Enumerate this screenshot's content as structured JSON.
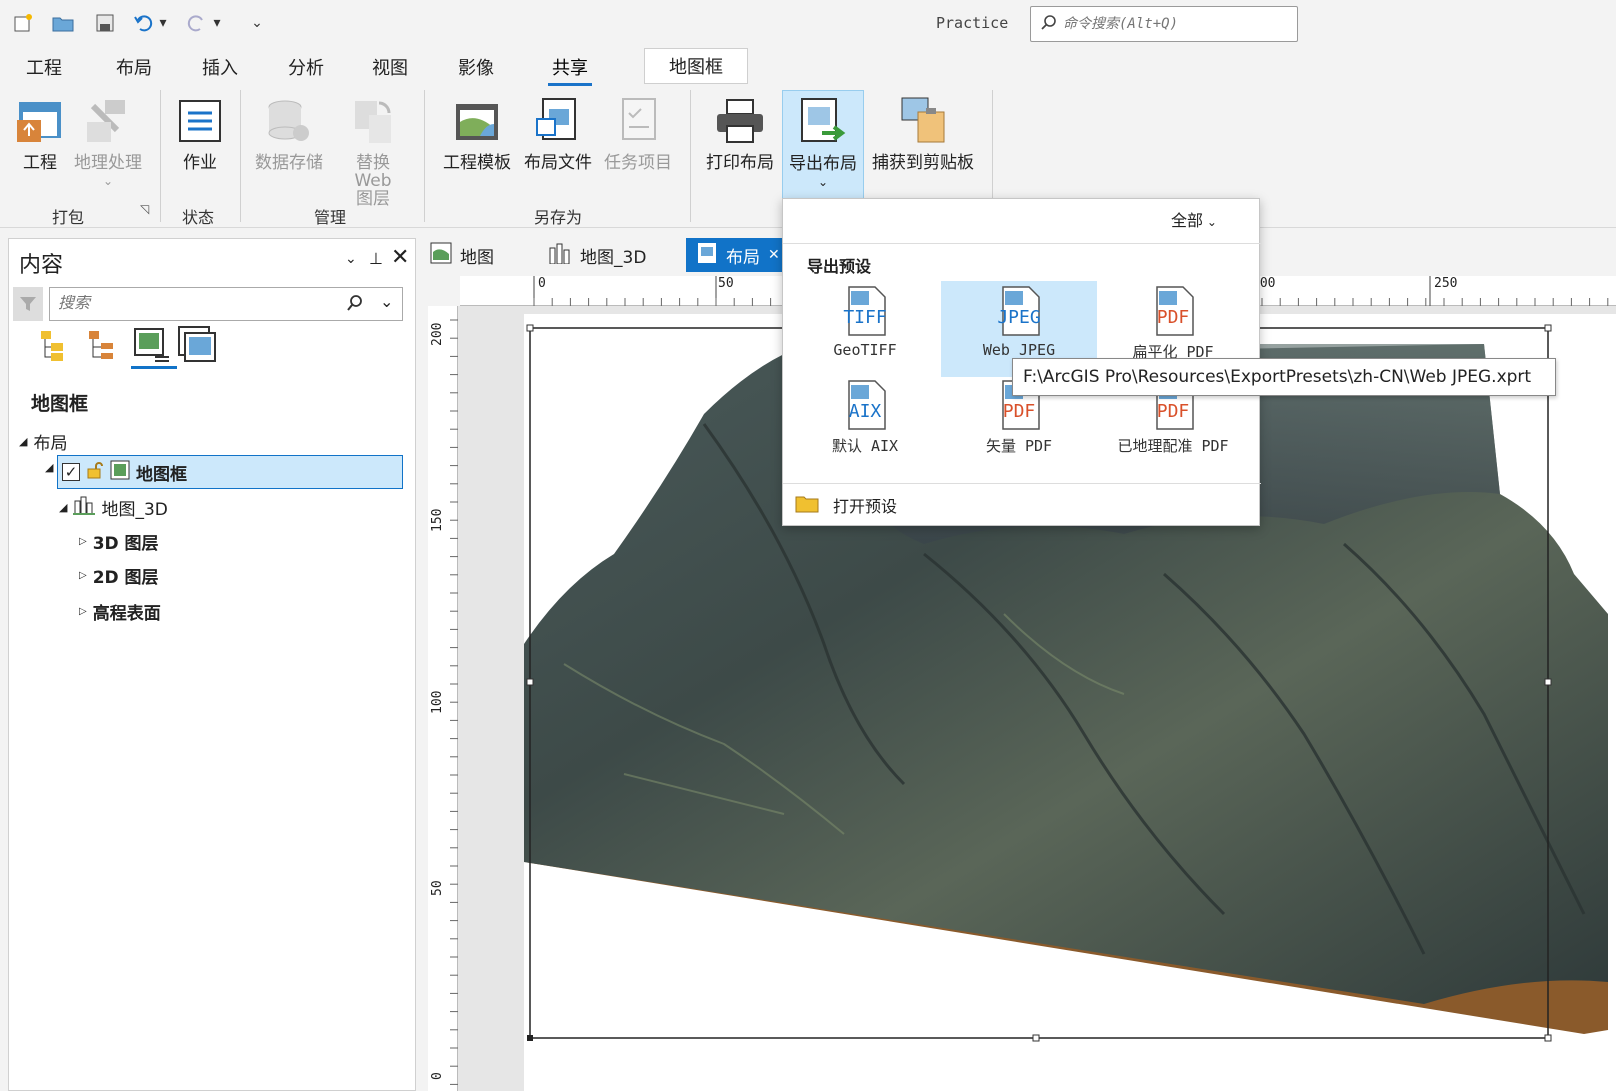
{
  "project_name": "Practice",
  "command_search": {
    "placeholder": "命令搜索(Alt+Q)"
  },
  "tabs": [
    {
      "label": "工程"
    },
    {
      "label": "布局"
    },
    {
      "label": "插入"
    },
    {
      "label": "分析"
    },
    {
      "label": "视图"
    },
    {
      "label": "影像"
    },
    {
      "label": "共享"
    }
  ],
  "contextual_tab": "地图框",
  "ribbon": {
    "project": "工程",
    "geoprocessing": "地理处理",
    "job": "作业",
    "datastore": "数据存储",
    "replace_web_layer_1": "替换 Web",
    "replace_web_layer_2": "图层",
    "project_template": "工程模板",
    "layout_file": "布局文件",
    "task_item": "任务项目",
    "print_layout": "打印布局",
    "export_layout": "导出布局",
    "capture_clipboard": "捕获到剪贴板",
    "groups": {
      "package": "打包",
      "status": "状态",
      "manage": "管理",
      "save_as": "另存为"
    }
  },
  "contents": {
    "title": "内容",
    "search_placeholder": "搜索",
    "heading": "地图框",
    "tree": {
      "layout": "布局",
      "mapframe": "地图框",
      "map3d": "地图_3D",
      "layers3d": "3D 图层",
      "layers2d": "2D 图层",
      "elevation": "高程表面"
    }
  },
  "view_tabs": [
    {
      "label": "地图"
    },
    {
      "label": "地图_3D"
    },
    {
      "label": "布局"
    }
  ],
  "ruler": {
    "top": [
      "0",
      "50",
      "200",
      "250"
    ],
    "left": [
      "200",
      "150",
      "100",
      "50",
      "0"
    ]
  },
  "export_dropdown": {
    "filter": "全部",
    "section": "导出预设",
    "presets": [
      {
        "badge": "TIFF",
        "label": "GeoTIFF",
        "color": "#1a73c9"
      },
      {
        "badge": "JPEG",
        "label": "Web JPEG",
        "color": "#1a73c9"
      },
      {
        "badge": "PDF",
        "label": "扁平化 PDF",
        "color": "#d9502a"
      },
      {
        "badge": "AIX",
        "label": "默认 AIX",
        "color": "#1a73c9"
      },
      {
        "badge": "PDF",
        "label": "矢量 PDF",
        "color": "#d9502a"
      },
      {
        "badge": "PDF",
        "label": "已地理配准 PDF",
        "color": "#d9502a"
      }
    ],
    "open_preset": "打开预设"
  },
  "tooltip": "F:\\ArcGIS Pro\\Resources\\ExportPresets\\zh-CN\\Web JPEG.xprt",
  "colors": {
    "accent": "#1173c8",
    "selected": "#cce8fb",
    "terrain_base": "#8a5a2b"
  }
}
